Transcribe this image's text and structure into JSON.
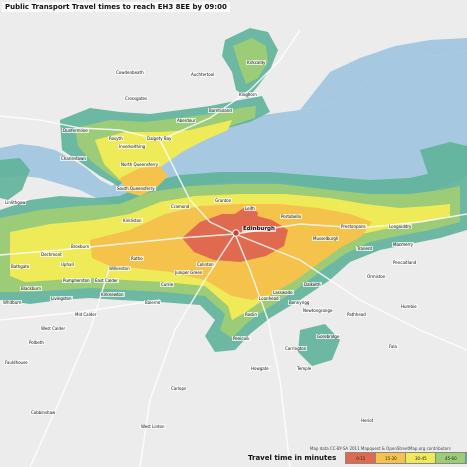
{
  "title": "Public Transport Travel times to reach EH3 8EE by 09:00",
  "legend": {
    "title": "Travel time in minutes",
    "bands": [
      {
        "label": "0-15",
        "color": "#e06a4f"
      },
      {
        "label": "15-30",
        "color": "#f5c24c"
      },
      {
        "label": "30-45",
        "color": "#eeea58"
      },
      {
        "label": "45-60",
        "color": "#9ccc78"
      },
      {
        "label": "60-75",
        "color": "#5fb39a"
      }
    ]
  },
  "attribution": "Map data CC-BY-SA 2011 Mapquest & OpenStreetMap.org contributors",
  "colors": {
    "sea": "#a6c8e0",
    "land": "#ececec",
    "road": "#ffffff",
    "destination_marker": "#d63b2c"
  },
  "places": {
    "edinburgh": "Edinburgh",
    "leith": "Leith",
    "portobello": "Portobello",
    "musselburgh": "Musselburgh",
    "dalkeith": "Dalkeith",
    "bonnyrigg": "Bonnyrigg",
    "loanhead": "Loanhead",
    "penicuik": "Penicuik",
    "livingston": "Livingston",
    "broxburn": "Broxburn",
    "south_queensferry": "South Queensferry",
    "dunfermline": "Dunfermline",
    "inverkeithing": "Inverkeithing",
    "rosyth": "Rosyth",
    "dalgety_bay": "Dalgety Bay",
    "kirkcaldy": "Kirkcaldy",
    "cowdenbeath": "Cowdenbeath",
    "linlithgow": "Linlithgow",
    "bathgate": "Bathgate",
    "tranent": "Tranent",
    "gorebridge": "Gorebridge",
    "west_calder": "West Calder",
    "currie": "Currie",
    "balerno": "Balerno",
    "pathhead": "Pathhead",
    "crossgates": "Crossgates",
    "kinghorn": "Kinghorn",
    "prestonpans": "Prestonpans",
    "cramond": "Cramond",
    "granton": "Granton",
    "ratho": "Ratho",
    "kirkliston": "Kirkliston",
    "east_calder": "East Calder",
    "mid_calder": "Mid Calder",
    "charlestown": "Charlestown",
    "north_queensferry": "North Queensferry",
    "aberdour": "Aberdour",
    "burntisland": "Burntisland",
    "lasswade": "Lasswade",
    "newtongrange": "Newtongrange",
    "roslin": "Roslin",
    "carrington": "Carrington",
    "temple": "Temple",
    "auchtertool": "Auchtertool",
    "dechmont": "Dechmont",
    "uphall": "Uphall",
    "pumpherston": "Pumpherston",
    "wilkieston": "Wilkieston",
    "juniper_green": "Juniper Green",
    "colinton": "Colinton",
    "kirknewton": "Kirknewton",
    "polbeth": "Polbeth",
    "blackburn": "Blackburn",
    "whitburn": "Whitburn",
    "fauldhouse": "Fauldhouse",
    "cobbinshaw": "Cobbinshaw",
    "west_linton": "West Linton",
    "carlops": "Carlops",
    "howgate": "Howgate",
    "heriot": "Heriot",
    "fala": "Fala",
    "humbie": "Humbie",
    "ormiston": "Ormiston",
    "pencaitland": "Pencaitland",
    "longniddry": "Longniddry",
    "macmerry": "Macmerry"
  }
}
